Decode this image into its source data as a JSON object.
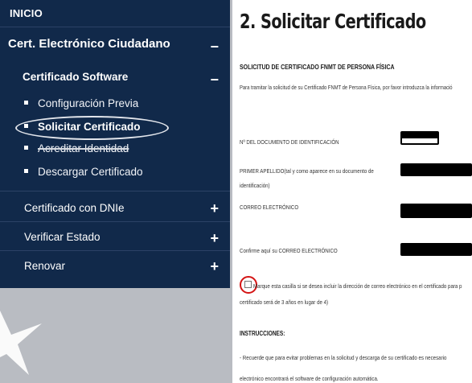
{
  "sidebar": {
    "inicio": "INICIO",
    "cert_section": {
      "label": "Cert. Electrónico Ciudadano",
      "toggle": "−"
    },
    "software_section": {
      "label": "Certificado Software",
      "toggle": "−"
    },
    "software_items": [
      {
        "label": "Configuración Previa"
      },
      {
        "label": "Solicitar Certificado"
      },
      {
        "label": "Acreditar Identidad"
      },
      {
        "label": "Descargar Certificado"
      }
    ],
    "main_items": [
      {
        "label": "Certificado con DNIe",
        "toggle": "+"
      },
      {
        "label": "Verificar Estado",
        "toggle": "+"
      },
      {
        "label": "Renovar",
        "toggle": "+"
      }
    ],
    "colors": {
      "background": "#11294a",
      "text": "#ffffff"
    }
  },
  "form": {
    "title": "2. Solicitar Certificado",
    "subtitle": "SOLICITUD DE CERTIFICADO FNMT DE PERSONA FÍSICA",
    "intro": "Para tramitar la solicitud de su Certificado FNMT de Persona Física, por favor introduzca la informació",
    "fields": [
      {
        "label": "Nº DEL DOCUMENTO DE IDENTIFICACIÓN",
        "value": ""
      },
      {
        "label": "PRIMER APELLIDO(tal y como aparece en su documento de",
        "label_cont": "identificación)",
        "value": ""
      },
      {
        "label": "CORREO ELECTRÓNICO",
        "value": ""
      },
      {
        "label": "Confirme aquí su CORREO ELECTRÓNICO",
        "value": ""
      }
    ],
    "checkbox": {
      "label": "Marque esta casilla si se desea incluir la dirección de correo electrónico en el certificado para p",
      "label_cont": "certificado será de 3 años en lugar de 4)",
      "checked": false,
      "highlight_color": "#d41414"
    },
    "instructions_heading": "INSTRUCCIONES:",
    "instructions": [
      "- Recuerde que para evitar problemas en la solicitud y descarga de su certificado es necesario",
      "electrónico encontrará el software de configuración automática."
    ]
  }
}
